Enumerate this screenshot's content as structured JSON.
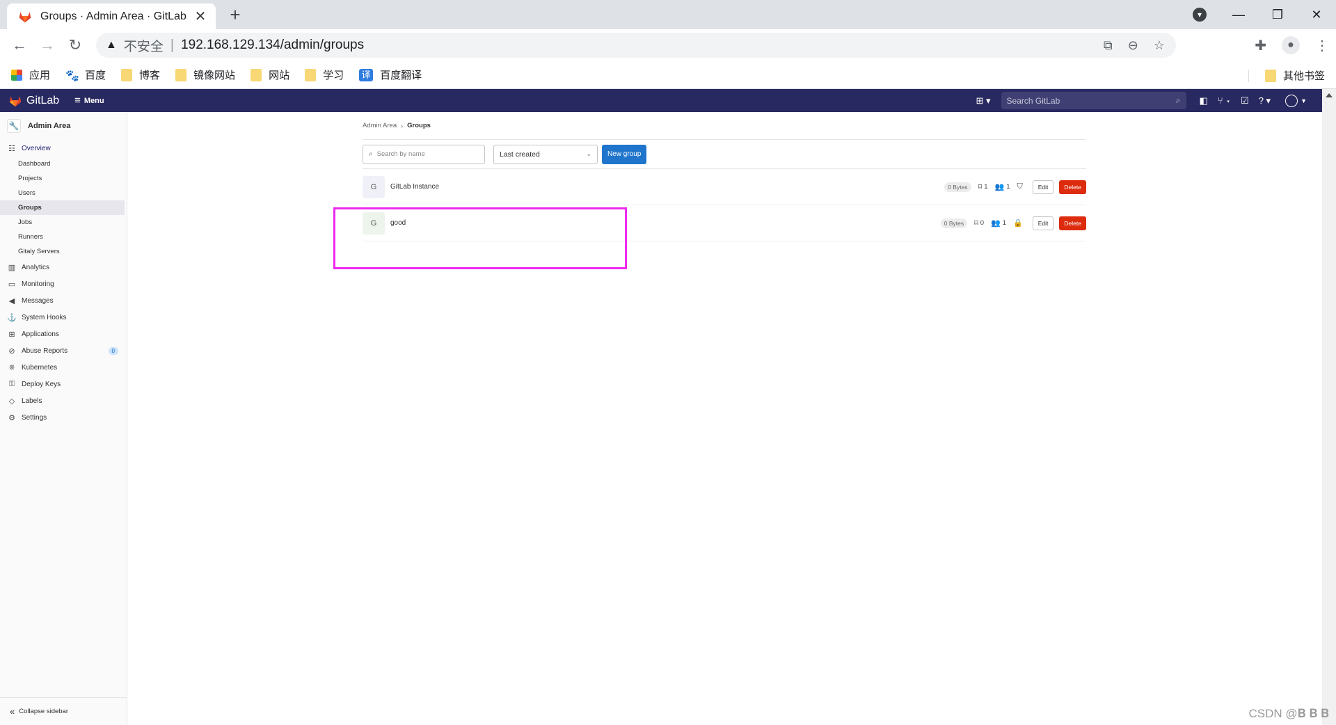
{
  "browser": {
    "tab_title": "Groups · Admin Area · GitLab",
    "tab_close": "✕",
    "new_tab": "+",
    "back": "←",
    "forward": "→",
    "reload": "↻",
    "security_warning": "不安全",
    "url": "192.168.129.134/admin/groups",
    "window": {
      "minimize": "—",
      "restore": "❐",
      "close": "✕"
    },
    "bookmarks": [
      {
        "label": "应用",
        "icon": "apps-grid-icon"
      },
      {
        "label": "百度",
        "icon": "baidu-paw-icon"
      },
      {
        "label": "博客",
        "icon": "folder-icon"
      },
      {
        "label": "镜像网站",
        "icon": "folder-icon"
      },
      {
        "label": "网站",
        "icon": "folder-icon"
      },
      {
        "label": "学习",
        "icon": "folder-icon"
      },
      {
        "label": "百度翻译",
        "icon": "translate-icon"
      }
    ],
    "translate_glyph": "译",
    "other_bookmarks": "其他书签"
  },
  "gitlab_header": {
    "logo": "GitLab",
    "menu": "Menu",
    "search_placeholder": "Search GitLab"
  },
  "sidebar": {
    "title": "Admin Area",
    "overview": "Overview",
    "overview_items": [
      "Dashboard",
      "Projects",
      "Users",
      "Groups",
      "Jobs",
      "Runners",
      "Gitaly Servers"
    ],
    "sections": [
      {
        "label": "Analytics",
        "icon": "chart-icon"
      },
      {
        "label": "Monitoring",
        "icon": "monitor-icon"
      },
      {
        "label": "Messages",
        "icon": "megaphone-icon"
      },
      {
        "label": "System Hooks",
        "icon": "hook-icon"
      },
      {
        "label": "Applications",
        "icon": "apps-icon"
      },
      {
        "label": "Abuse Reports",
        "icon": "abuse-icon",
        "badge": "0"
      },
      {
        "label": "Kubernetes",
        "icon": "kubernetes-icon"
      },
      {
        "label": "Deploy Keys",
        "icon": "key-icon"
      },
      {
        "label": "Labels",
        "icon": "label-icon"
      },
      {
        "label": "Settings",
        "icon": "settings-icon"
      }
    ],
    "collapse": "Collapse sidebar"
  },
  "main": {
    "breadcrumb": [
      "Admin Area",
      "Groups"
    ],
    "search_placeholder": "Search by name",
    "sort_value": "Last created",
    "new_group": "New group",
    "groups": [
      {
        "avatar": "G",
        "name": "GitLab Instance",
        "size": "0 Bytes",
        "projects": "1",
        "members": "1",
        "visibility": "internal-shield-icon",
        "edit": "Edit",
        "delete": "Delete"
      },
      {
        "avatar": "G",
        "name": "good",
        "size": "0 Bytes",
        "projects": "0",
        "members": "1",
        "visibility": "private-lock-icon",
        "edit": "Edit",
        "delete": "Delete"
      }
    ]
  },
  "watermark": "CSDN @𝐁 𝐁 𝐁",
  "colors": {
    "gitlab_nav": "#292961",
    "primary_button": "#1f75cb",
    "danger_button": "#dd2b0e",
    "highlight_annotation": "#ee29ee"
  }
}
